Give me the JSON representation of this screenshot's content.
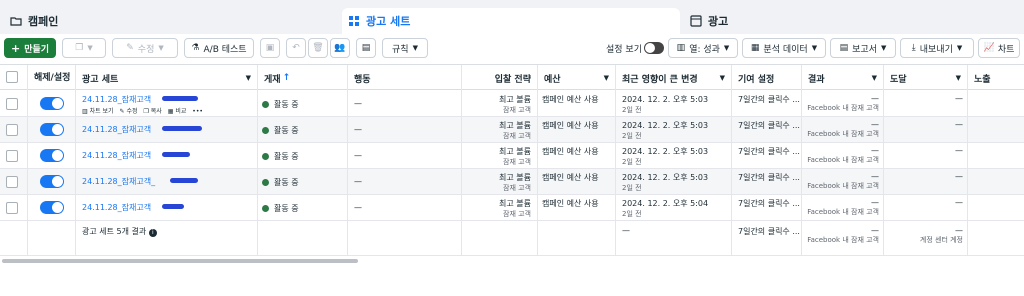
{
  "tabs": [
    {
      "label": "캠페인",
      "icon": "folder-icon"
    },
    {
      "label": "광고 세트",
      "icon": "grid-icon"
    },
    {
      "label": "광고",
      "icon": "ad-icon"
    }
  ],
  "toolbar": {
    "create_label": "만들기",
    "edit_label": "수정",
    "ab_test_label": "A/B 테스트",
    "rules_label": "규칙",
    "show_settings_label": "설정 보기",
    "columns_label": "열: 성과",
    "breakdown_label": "분석 데이터",
    "reports_label": "보고서",
    "export_label": "내보내기",
    "chart_label": "차트"
  },
  "table": {
    "headers": {
      "onoff": "해제/설정",
      "adset": "광고 세트",
      "delivery": "게재",
      "action": "행동",
      "bid": "입찰 전략",
      "budget": "예산",
      "last_change": "최근 영향이 큰 변경",
      "attribution": "기여 설정",
      "results": "결과",
      "reach": "도달",
      "impressions": "노출"
    },
    "row_actions": {
      "chart": "차트 보기",
      "edit": "수정",
      "duplicate": "복사",
      "compare": "비교",
      "more": "•••"
    },
    "rows": [
      {
        "name": "24.11.28_잠재고객",
        "delivery": "활동 중",
        "action": "—",
        "bid": "최고 볼륨",
        "bid_sub": "잠재 고객",
        "budget": "캠페인 예산 사용",
        "change": "2024. 12. 2. 오후 5:03",
        "change_sub": "2일 전",
        "attribution": "7일간의 클릭수 ...",
        "results": "—",
        "results_sub": "Facebook 내 잠재 고객",
        "reach": "—"
      },
      {
        "name": "24.11.28_잠재고객",
        "delivery": "활동 중",
        "action": "—",
        "bid": "최고 볼륨",
        "bid_sub": "잠재 고객",
        "budget": "캠페인 예산 사용",
        "change": "2024. 12. 2. 오후 5:03",
        "change_sub": "2일 전",
        "attribution": "7일간의 클릭수 ...",
        "results": "—",
        "results_sub": "Facebook 내 잠재 고객",
        "reach": "—"
      },
      {
        "name": "24.11.28_잠재고객",
        "delivery": "활동 중",
        "action": "—",
        "bid": "최고 볼륨",
        "bid_sub": "잠재 고객",
        "budget": "캠페인 예산 사용",
        "change": "2024. 12. 2. 오후 5:03",
        "change_sub": "2일 전",
        "attribution": "7일간의 클릭수 ...",
        "results": "—",
        "results_sub": "Facebook 내 잠재 고객",
        "reach": "—"
      },
      {
        "name": "24.11.28_잠재고객_",
        "delivery": "활동 중",
        "action": "—",
        "bid": "최고 볼륨",
        "bid_sub": "잠재 고객",
        "budget": "캠페인 예산 사용",
        "change": "2024. 12. 2. 오후 5:03",
        "change_sub": "2일 전",
        "attribution": "7일간의 클릭수 ...",
        "results": "—",
        "results_sub": "Facebook 내 잠재 고객",
        "reach": "—"
      },
      {
        "name": "24.11.28_잠재고객",
        "delivery": "활동 중",
        "action": "—",
        "bid": "최고 볼륨",
        "bid_sub": "잠재 고객",
        "budget": "캠페인 예산 사용",
        "change": "2024. 12. 2. 오후 5:04",
        "change_sub": "2일 전",
        "attribution": "7일간의 클릭수 ...",
        "results": "—",
        "results_sub": "Facebook 내 잠재 고객",
        "reach": "—"
      }
    ],
    "summary": {
      "label": "광고 세트 5개 결과",
      "change": "—",
      "attribution": "7일간의 클릭수 ...",
      "results": "—",
      "results_sub": "Facebook 내 잠재 고객",
      "reach": "—",
      "reach_sub": "계정 센터 계정"
    }
  },
  "colors": {
    "accent": "#1877f2",
    "create_button": "#1b7f3b",
    "active_dot": "#2c7a46",
    "redaction": "#2846d6"
  }
}
